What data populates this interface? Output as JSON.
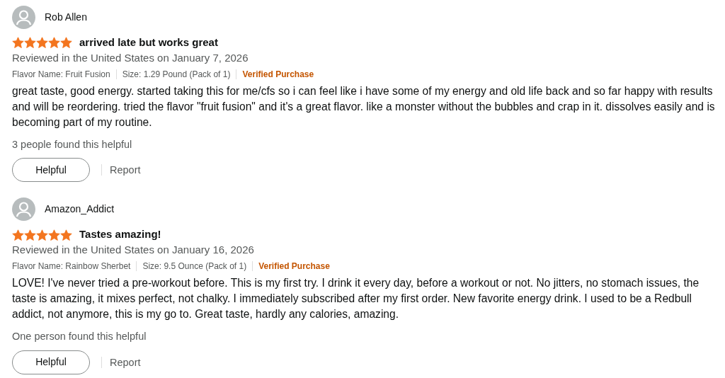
{
  "reviews": [
    {
      "author": "Rob Allen",
      "stars": 5,
      "title": "arrived late but works great",
      "date": "Reviewed in the United States on January 7, 2026",
      "details": [
        "Flavor Name: Fruit Fusion",
        "Size: 1.29 Pound (Pack of 1)"
      ],
      "verified": "Verified Purchase",
      "body": "great taste, good energy. started taking this for me/cfs so i can feel like i have some of my energy and old life back and so far happy with results and will be reordering. tried the flavor \"fruit fusion\" and it's a great flavor. like a monster without the bubbles and crap in it. dissolves easily and is becoming part of my routine.",
      "helpful_count": "3 people found this helpful",
      "helpful_button": "Helpful",
      "report": "Report"
    },
    {
      "author": "Amazon_Addict",
      "stars": 5,
      "title": "Tastes amazing!",
      "date": "Reviewed in the United States on January 16, 2026",
      "details": [
        "Flavor Name: Rainbow Sherbet",
        "Size: 9.5 Ounce (Pack of 1)"
      ],
      "verified": "Verified Purchase",
      "body": "LOVE! I've never tried a pre-workout before. This is my first try. I drink it every day, before a workout or not. No jitters, no stomach issues, the taste is amazing, it mixes perfect, not chalky. I immediately subscribed after my first order. New favorite energy drink. I used to be a Redbull addict, not anymore, this is my go to. Great taste, hardly any calories, amazing.",
      "helpful_count": "One person found this helpful",
      "helpful_button": "Helpful",
      "report": "Report"
    }
  ]
}
